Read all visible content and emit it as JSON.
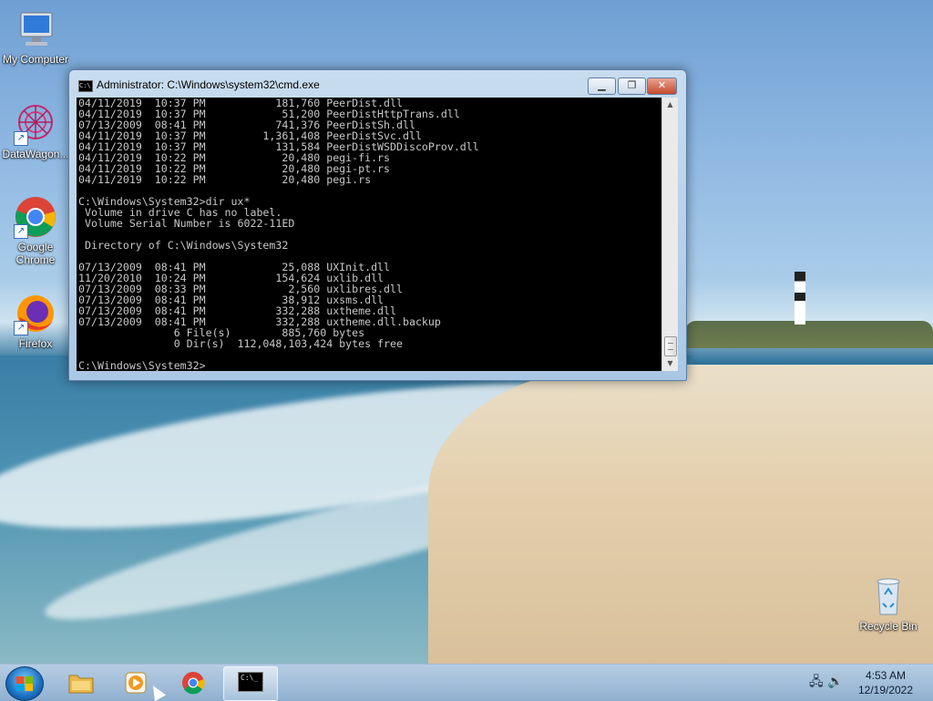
{
  "desktop": {
    "icons": [
      {
        "label": "My Computer",
        "icon": "computer-icon"
      },
      {
        "label": "DataWagon...",
        "icon": "datawagon-icon"
      },
      {
        "label": "Google Chrome",
        "icon": "chrome-icon"
      },
      {
        "label": "Firefox",
        "icon": "firefox-icon"
      },
      {
        "label": "Recycle Bin",
        "icon": "recycle-bin-icon"
      }
    ]
  },
  "window": {
    "title": "Administrator: C:\\Windows\\system32\\cmd.exe",
    "title_icon_text": "C:\\"
  },
  "console": {
    "lines": [
      "04/11/2019  10:37 PM           181,760 PeerDist.dll",
      "04/11/2019  10:37 PM            51,200 PeerDistHttpTrans.dll",
      "07/13/2009  08:41 PM           741,376 PeerDistSh.dll",
      "04/11/2019  10:37 PM         1,361,408 PeerDistSvc.dll",
      "04/11/2019  10:37 PM           131,584 PeerDistWSDDiscoProv.dll",
      "04/11/2019  10:22 PM            20,480 pegi-fi.rs",
      "04/11/2019  10:22 PM            20,480 pegi-pt.rs",
      "04/11/2019  10:22 PM            20,480 pegi.rs",
      "",
      "C:\\Windows\\System32>dir ux*",
      " Volume in drive C has no label.",
      " Volume Serial Number is 6022-11ED",
      "",
      " Directory of C:\\Windows\\System32",
      "",
      "07/13/2009  08:41 PM            25,088 UXInit.dll",
      "11/20/2010  10:24 PM           154,624 uxlib.dll",
      "07/13/2009  08:33 PM             2,560 uxlibres.dll",
      "07/13/2009  08:41 PM            38,912 uxsms.dll",
      "07/13/2009  08:41 PM           332,288 uxtheme.dll",
      "07/13/2009  08:41 PM           332,288 uxtheme.dll.backup",
      "               6 File(s)        885,760 bytes",
      "               0 Dir(s)  112,048,103,424 bytes free",
      "",
      "C:\\Windows\\System32>"
    ]
  },
  "taskbar": {
    "items": [
      {
        "name": "file-explorer",
        "icon": "folder-icon"
      },
      {
        "name": "media-player",
        "icon": "media-player-icon"
      },
      {
        "name": "chrome",
        "icon": "chrome-icon"
      },
      {
        "name": "cmd",
        "icon": "cmd-icon",
        "text": "C:\\_"
      }
    ],
    "clock": {
      "time": "4:53 AM",
      "date": "12/19/2022"
    }
  }
}
